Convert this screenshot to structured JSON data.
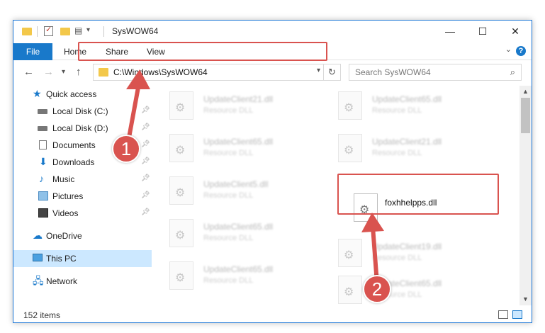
{
  "window": {
    "title": "SysWOW64",
    "controls": {
      "minimize": "—",
      "maximize": "☐",
      "close": "✕"
    }
  },
  "ribbon": {
    "tabs": [
      "File",
      "Home",
      "Share",
      "View"
    ],
    "help": "?"
  },
  "address": {
    "path": "C:\\Windows\\SysWOW64",
    "search_placeholder": "Search SysWOW64"
  },
  "nav": {
    "items": [
      {
        "label": "Quick access",
        "icon": "star-icon"
      },
      {
        "label": "Local Disk (C:)",
        "icon": "drive-icon",
        "pinned": true
      },
      {
        "label": "Local Disk (D:)",
        "icon": "drive-icon",
        "pinned": true
      },
      {
        "label": "Documents",
        "icon": "documents-icon",
        "pinned": true
      },
      {
        "label": "Downloads",
        "icon": "download-icon",
        "pinned": true
      },
      {
        "label": "Music",
        "icon": "music-icon",
        "pinned": true
      },
      {
        "label": "Pictures",
        "icon": "pictures-icon",
        "pinned": true
      },
      {
        "label": "Videos",
        "icon": "videos-icon",
        "pinned": true
      },
      {
        "label": "OneDrive",
        "icon": "cloud-icon"
      },
      {
        "label": "This PC",
        "icon": "pc-icon",
        "selected": true
      },
      {
        "label": "Network",
        "icon": "network-icon"
      }
    ]
  },
  "files": [
    {
      "name": "UpdateClient21.dll",
      "desc": "Resource DLL"
    },
    {
      "name": "UpdateClient65.dll",
      "desc": "Resource DLL"
    },
    {
      "name": "UpdateClient65.dll",
      "desc": "Resource DLL"
    },
    {
      "name": "UpdateClient21.dll",
      "desc": "Resource DLL"
    },
    {
      "name": "UpdateClient5.dll",
      "desc": "Resource DLL"
    },
    {
      "name": "foxhhelpps.dll",
      "desc": ""
    },
    {
      "name": "UpdateClient65.dll",
      "desc": "Resource DLL"
    },
    {
      "name": "UpdateClient19.dll",
      "desc": "Resource DLL"
    },
    {
      "name": "UpdateClient65.dll",
      "desc": "Resource DLL"
    },
    {
      "name": "UpdateClient65.dll",
      "desc": "Resource DLL"
    }
  ],
  "status": {
    "item_count": "152 items"
  },
  "callouts": [
    "1",
    "2"
  ],
  "colors": {
    "accent": "#1979ca",
    "callout": "#d9534f",
    "selection": "#cce8ff"
  }
}
